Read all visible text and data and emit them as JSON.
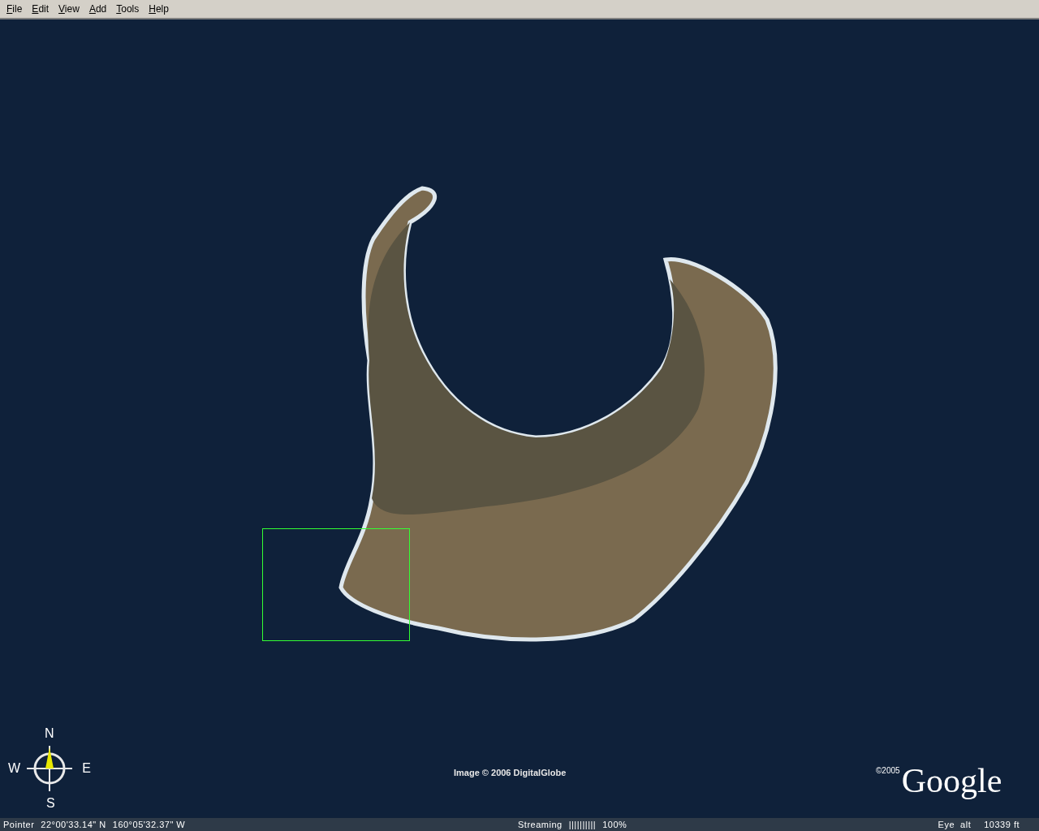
{
  "menu": [
    "File",
    "Edit",
    "View",
    "Add",
    "Tools",
    "Help"
  ],
  "map": {
    "imagery_credit": "Image © 2006 DigitalGlobe",
    "compass": {
      "north": "N",
      "east": "E",
      "south": "S",
      "west": "W"
    },
    "logo": {
      "copyright": "©2005",
      "name": "Google"
    }
  },
  "status_bar": {
    "pointer_label": "Pointer",
    "latitude": "22°00'33.14\" N",
    "longitude": "160°05'32.37\" W",
    "streaming_label": "Streaming",
    "streaming_bars": "||||||||||",
    "streaming_percent": "100%",
    "eye_alt_label": "Eye  alt",
    "eye_alt_value": "10339 ft"
  }
}
